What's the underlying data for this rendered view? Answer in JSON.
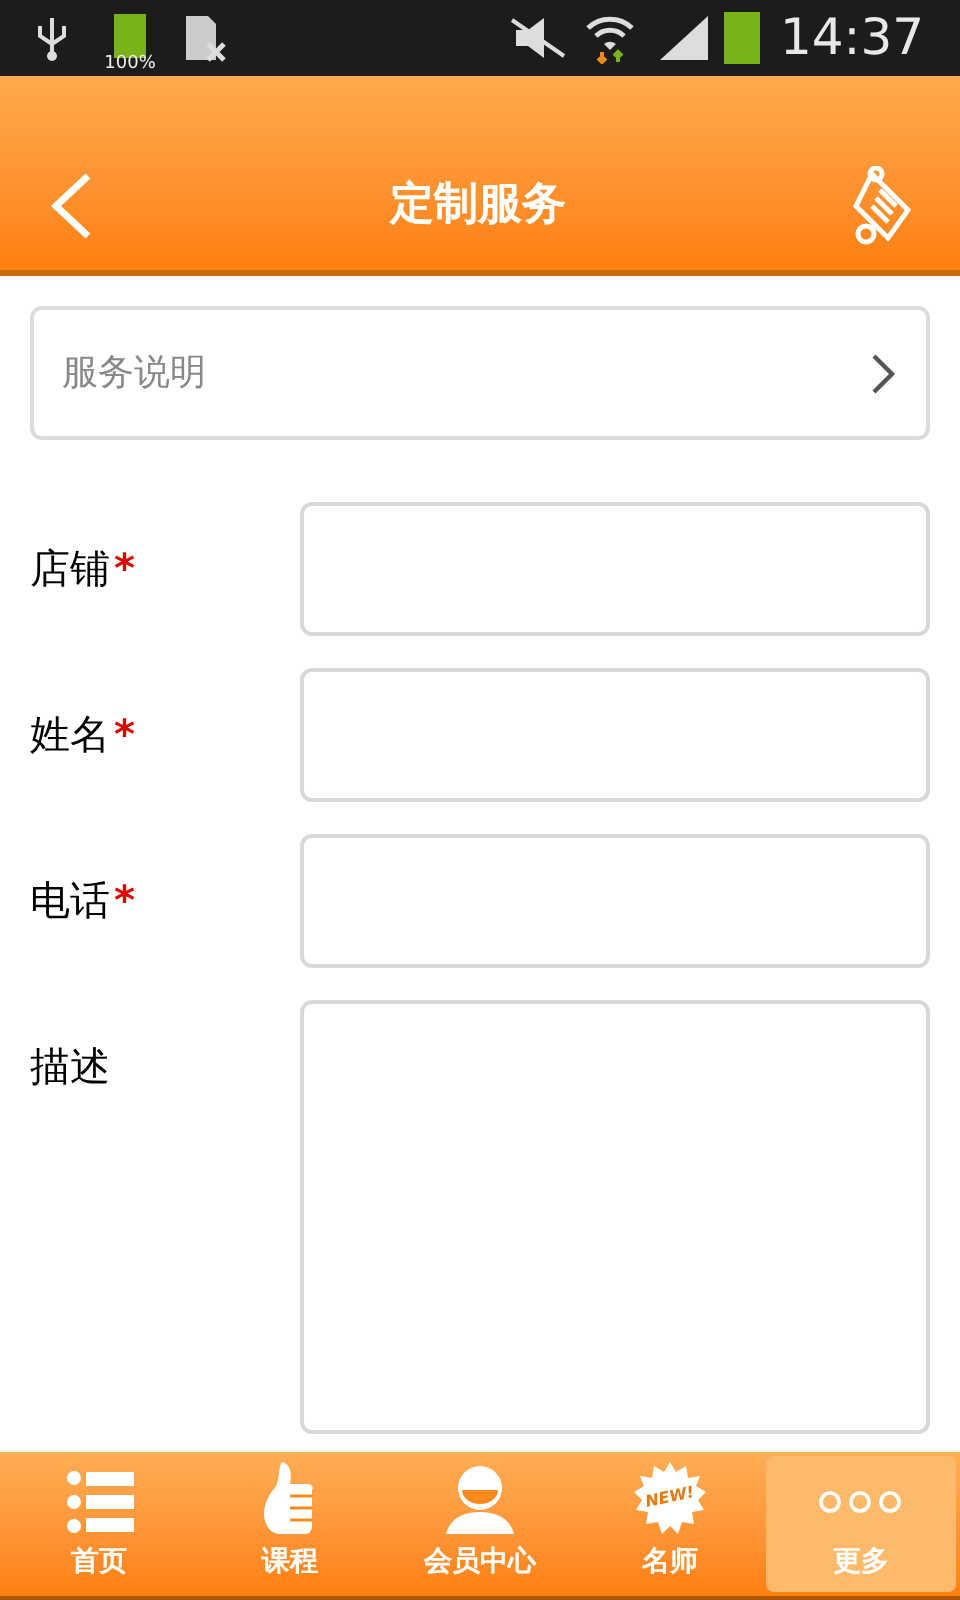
{
  "status_bar": {
    "battery_percent": "100%",
    "time": "14:37"
  },
  "header": {
    "title": "定制服务"
  },
  "service_link": {
    "label": "服务说明"
  },
  "form": [
    {
      "label": "店铺",
      "required_mark": "*",
      "kind": "input"
    },
    {
      "label": "姓名",
      "required_mark": "*",
      "kind": "input"
    },
    {
      "label": "电话",
      "required_mark": "*",
      "kind": "input"
    },
    {
      "label": "描述",
      "kind": "textarea"
    }
  ],
  "nav": [
    {
      "label": "首页",
      "kind": "list",
      "selected": false
    },
    {
      "label": "课程",
      "kind": "thumb",
      "selected": false
    },
    {
      "label": "会员中心",
      "kind": "person",
      "selected": false
    },
    {
      "label": "名师",
      "kind": "new",
      "badge": "NEW!",
      "selected": false
    },
    {
      "label": "更多",
      "kind": "more",
      "selected": true
    }
  ]
}
